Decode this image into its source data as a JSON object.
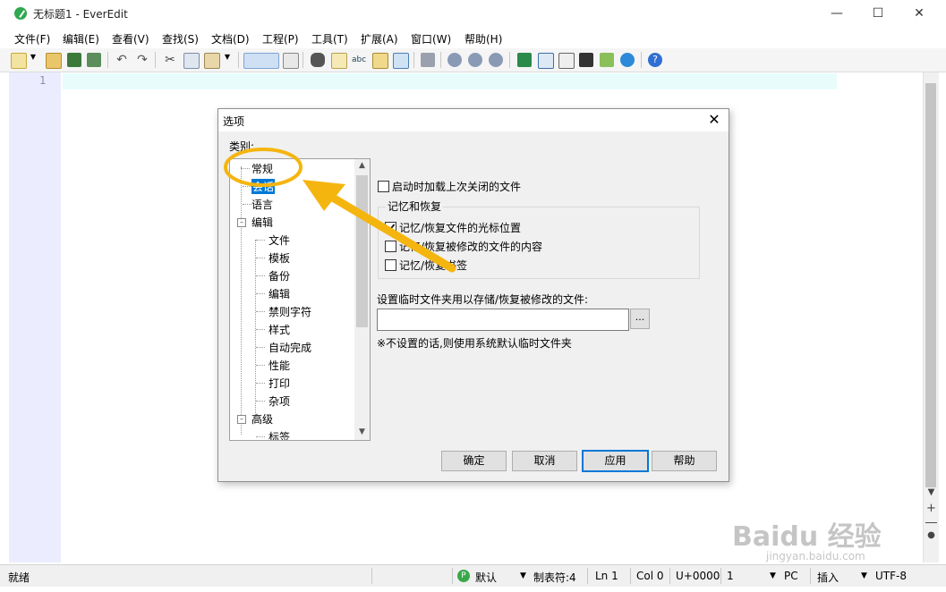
{
  "window": {
    "title": "无标题1 - EverEdit",
    "minimize_icon": "minimize-icon",
    "maximize_icon": "maximize-icon",
    "close_icon": "close-icon"
  },
  "menu": [
    "文件(F)",
    "编辑(E)",
    "查看(V)",
    "查找(S)",
    "文档(D)",
    "工程(P)",
    "工具(T)",
    "扩展(A)",
    "窗口(W)",
    "帮助(H)"
  ],
  "editor": {
    "line_number": "1"
  },
  "dialog": {
    "title": "选项",
    "category_label": "类别:",
    "tree": [
      {
        "label": "常规",
        "level": 1,
        "expanded": true
      },
      {
        "label": "会话",
        "level": 2,
        "selected": true
      },
      {
        "label": "语言",
        "level": 2
      },
      {
        "label": "编辑",
        "level": 1,
        "expanded": true
      },
      {
        "label": "文件",
        "level": 2
      },
      {
        "label": "模板",
        "level": 2
      },
      {
        "label": "备份",
        "level": 2
      },
      {
        "label": "编辑",
        "level": 2
      },
      {
        "label": "禁则字符",
        "level": 2
      },
      {
        "label": "样式",
        "level": 2
      },
      {
        "label": "自动完成",
        "level": 2
      },
      {
        "label": "性能",
        "level": 2
      },
      {
        "label": "打印",
        "level": 2
      },
      {
        "label": "杂项",
        "level": 2
      },
      {
        "label": "高级",
        "level": 1,
        "expanded": true
      },
      {
        "label": "标签",
        "level": 2
      }
    ],
    "load_last_closed": {
      "label": "启动时加载上次关闭的文件",
      "checked": false
    },
    "remember_group": {
      "title": "记忆和恢复",
      "options": [
        {
          "label": "记忆/恢复文件的光标位置",
          "checked": true
        },
        {
          "label": "记忆/恢复被修改的文件的内容",
          "checked": false
        },
        {
          "label": "记忆/恢复书签",
          "checked": false
        }
      ]
    },
    "temp_folder_label": "设置临时文件夹用以存储/恢复被修改的文件:",
    "temp_folder_value": "",
    "browse_label": "...",
    "note": "※不设置的话,则使用系统默认临时文件夹",
    "buttons": {
      "ok": "确定",
      "cancel": "取消",
      "apply": "应用",
      "help": "帮助"
    }
  },
  "status": {
    "ready": "就绪",
    "mode_badge": "P",
    "mode": "默认",
    "tab": "制表符:4",
    "line": "Ln 1",
    "col": "Col 0",
    "unicode": "U+0000",
    "value": "1",
    "eol": "PC",
    "insert": "插入",
    "encoding": "UTF-8"
  },
  "watermark": {
    "brand": "Baidu 经验",
    "url": "jingyan.baidu.com"
  },
  "colors": {
    "annotation": "#f5b50f",
    "selection": "#0078d7",
    "gutter": "#ececff",
    "current_line": "#e8fcfc"
  }
}
